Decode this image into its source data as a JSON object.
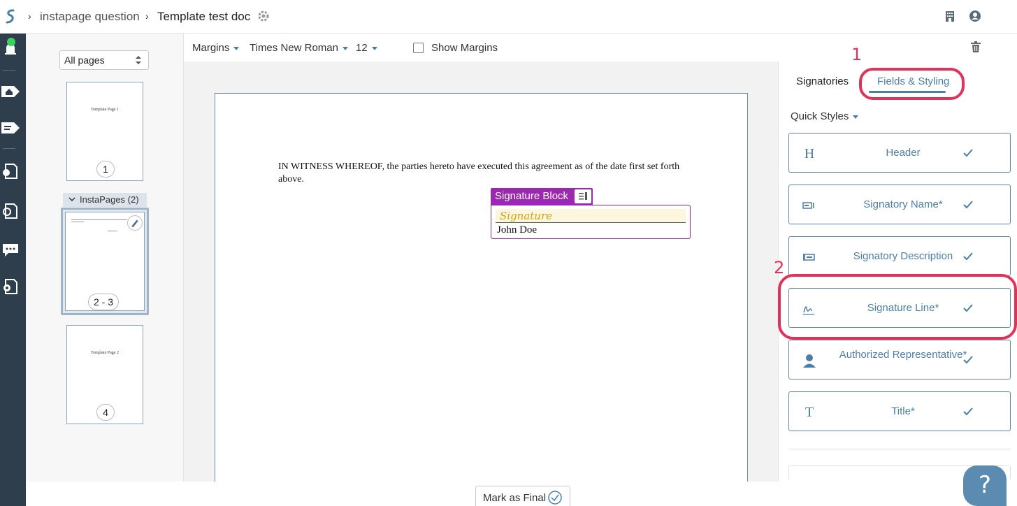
{
  "header": {
    "breadcrumb_parent": "instapage question",
    "doc_title": "Template test doc",
    "sep": "›"
  },
  "thumbnails": {
    "pages_select": "All pages",
    "page1_text": "Template Page 1",
    "page1_num": "1",
    "group_label": "InstaPages (2)",
    "group_num": "2 - 3",
    "page4_text": "Template Page 2",
    "page4_num": "4"
  },
  "toolbar": {
    "margins": "Margins",
    "font": "Times New Roman",
    "size": "12",
    "show_margins": "Show Margins"
  },
  "document": {
    "body_text": "IN WITNESS WHEREOF, the parties hereto have executed this agreement as of the date first set forth above.",
    "sigblock_label": "Signature Block",
    "signature_placeholder": "Signature",
    "signer_name": "John Doe"
  },
  "right_panel": {
    "tabs": [
      "Signatories",
      "Fields & Styling"
    ],
    "quick_styles": "Quick Styles",
    "styles": [
      {
        "label": "Header",
        "icon": "H"
      },
      {
        "label": "Signatory Name*",
        "icon": "name-field-icon"
      },
      {
        "label": "Signatory Description",
        "icon": "description-field-icon"
      },
      {
        "label": "Signature Line*",
        "icon": "signature-icon"
      },
      {
        "label": "Authorized Representative*",
        "icon": "person-icon"
      },
      {
        "label": "Title*",
        "icon": "T"
      }
    ]
  },
  "footer": {
    "mark_final": "Mark as Final"
  },
  "help": {
    "label": "?"
  },
  "annotations": {
    "one": "1",
    "two": "2",
    "color": "#e0335a"
  },
  "colors": {
    "nav_bg": "#2e3e4d",
    "accent": "#4a7fa8",
    "sigblock": "#9c27b0"
  }
}
